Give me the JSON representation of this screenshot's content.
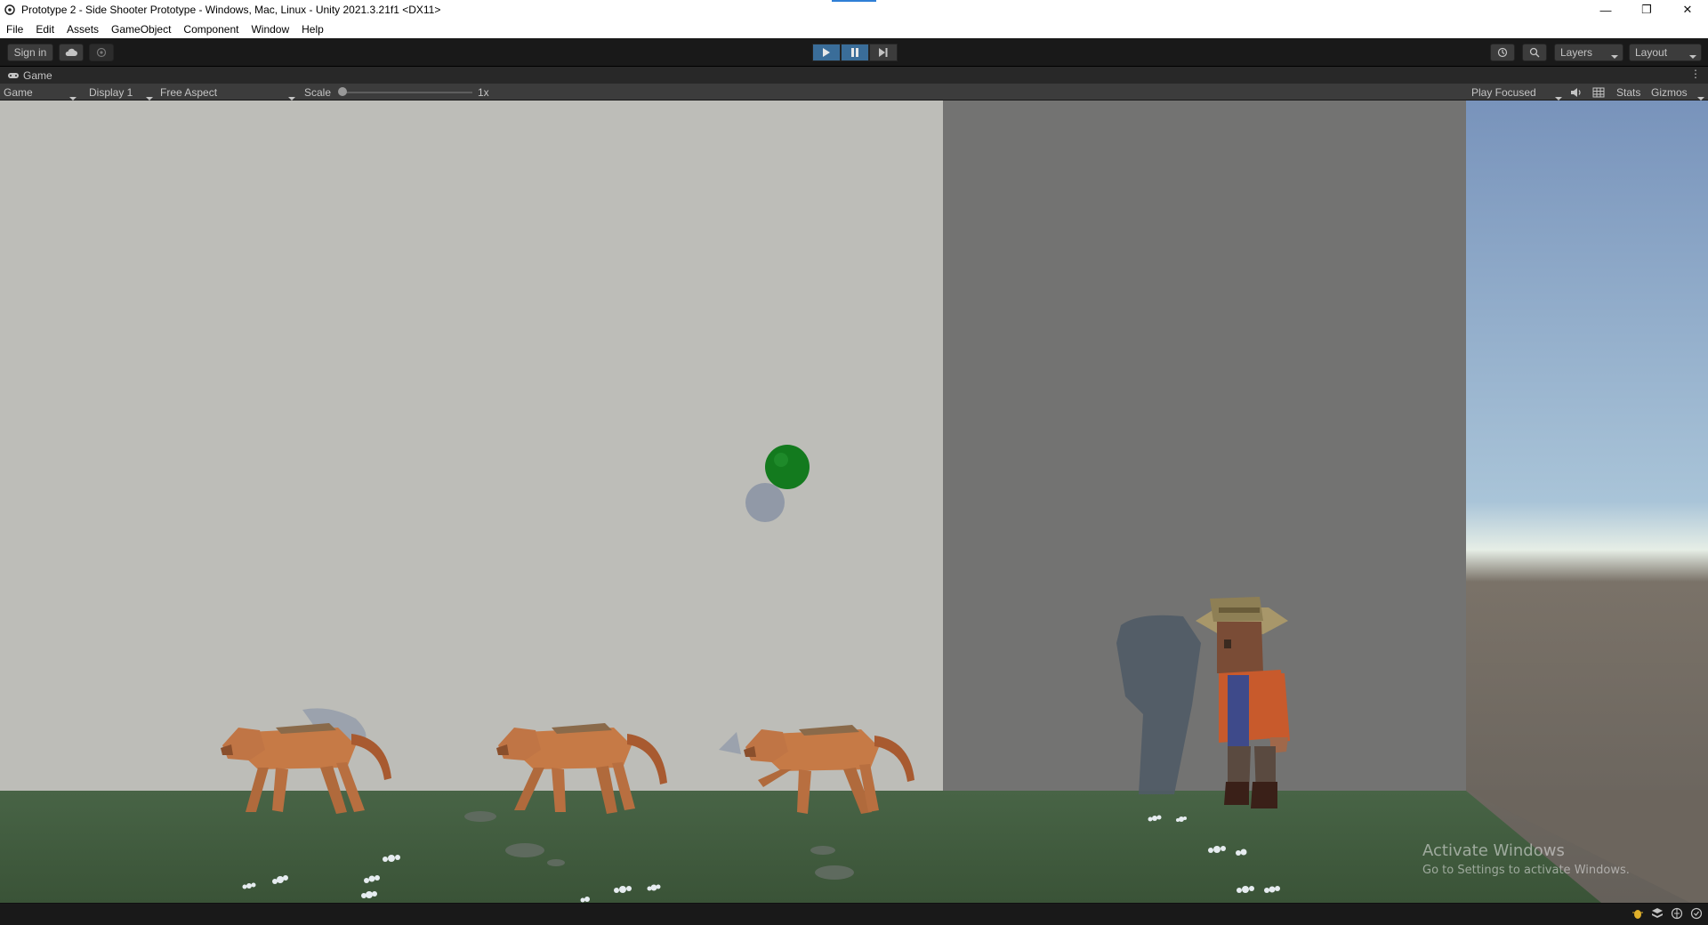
{
  "window": {
    "title": "Prototype 2 - Side Shooter Prototype - Windows, Mac, Linux - Unity 2021.3.21f1 <DX11>",
    "minimize_glyph": "—",
    "maximize_glyph": "❐",
    "close_glyph": "✕"
  },
  "menu": [
    "File",
    "Edit",
    "Assets",
    "GameObject",
    "Component",
    "Window",
    "Help"
  ],
  "toolbar": {
    "sign_in": "Sign in",
    "layers": "Layers",
    "layout": "Layout",
    "play_state": "playing"
  },
  "tab": {
    "label": "Game"
  },
  "game_toolbar": {
    "mode": "Game",
    "display": "Display 1",
    "aspect": "Free Aspect",
    "scale_label": "Scale",
    "scale_value": "1x",
    "scale_fraction": 0,
    "play_focused": "Play Focused",
    "stats": "Stats",
    "gizmos": "Gizmos"
  },
  "watermark": {
    "title": "Activate Windows",
    "subtitle": "Go to Settings to activate Windows."
  },
  "colors": {
    "play_active": "#3a6d99",
    "ground": "#3f5a3d",
    "wall_light": "#bdbdb8",
    "wall_dark": "#737372",
    "sky_top": "#7e9ac1",
    "projectile": "#137a1e",
    "dog": "#c67a46"
  },
  "icons": {
    "unity": "unity-icon",
    "cloud": "cloud-icon",
    "collab": "collab-icon",
    "history": "history-icon",
    "search": "search-icon",
    "mute": "speaker-icon",
    "stats_grid": "grid-icon"
  }
}
